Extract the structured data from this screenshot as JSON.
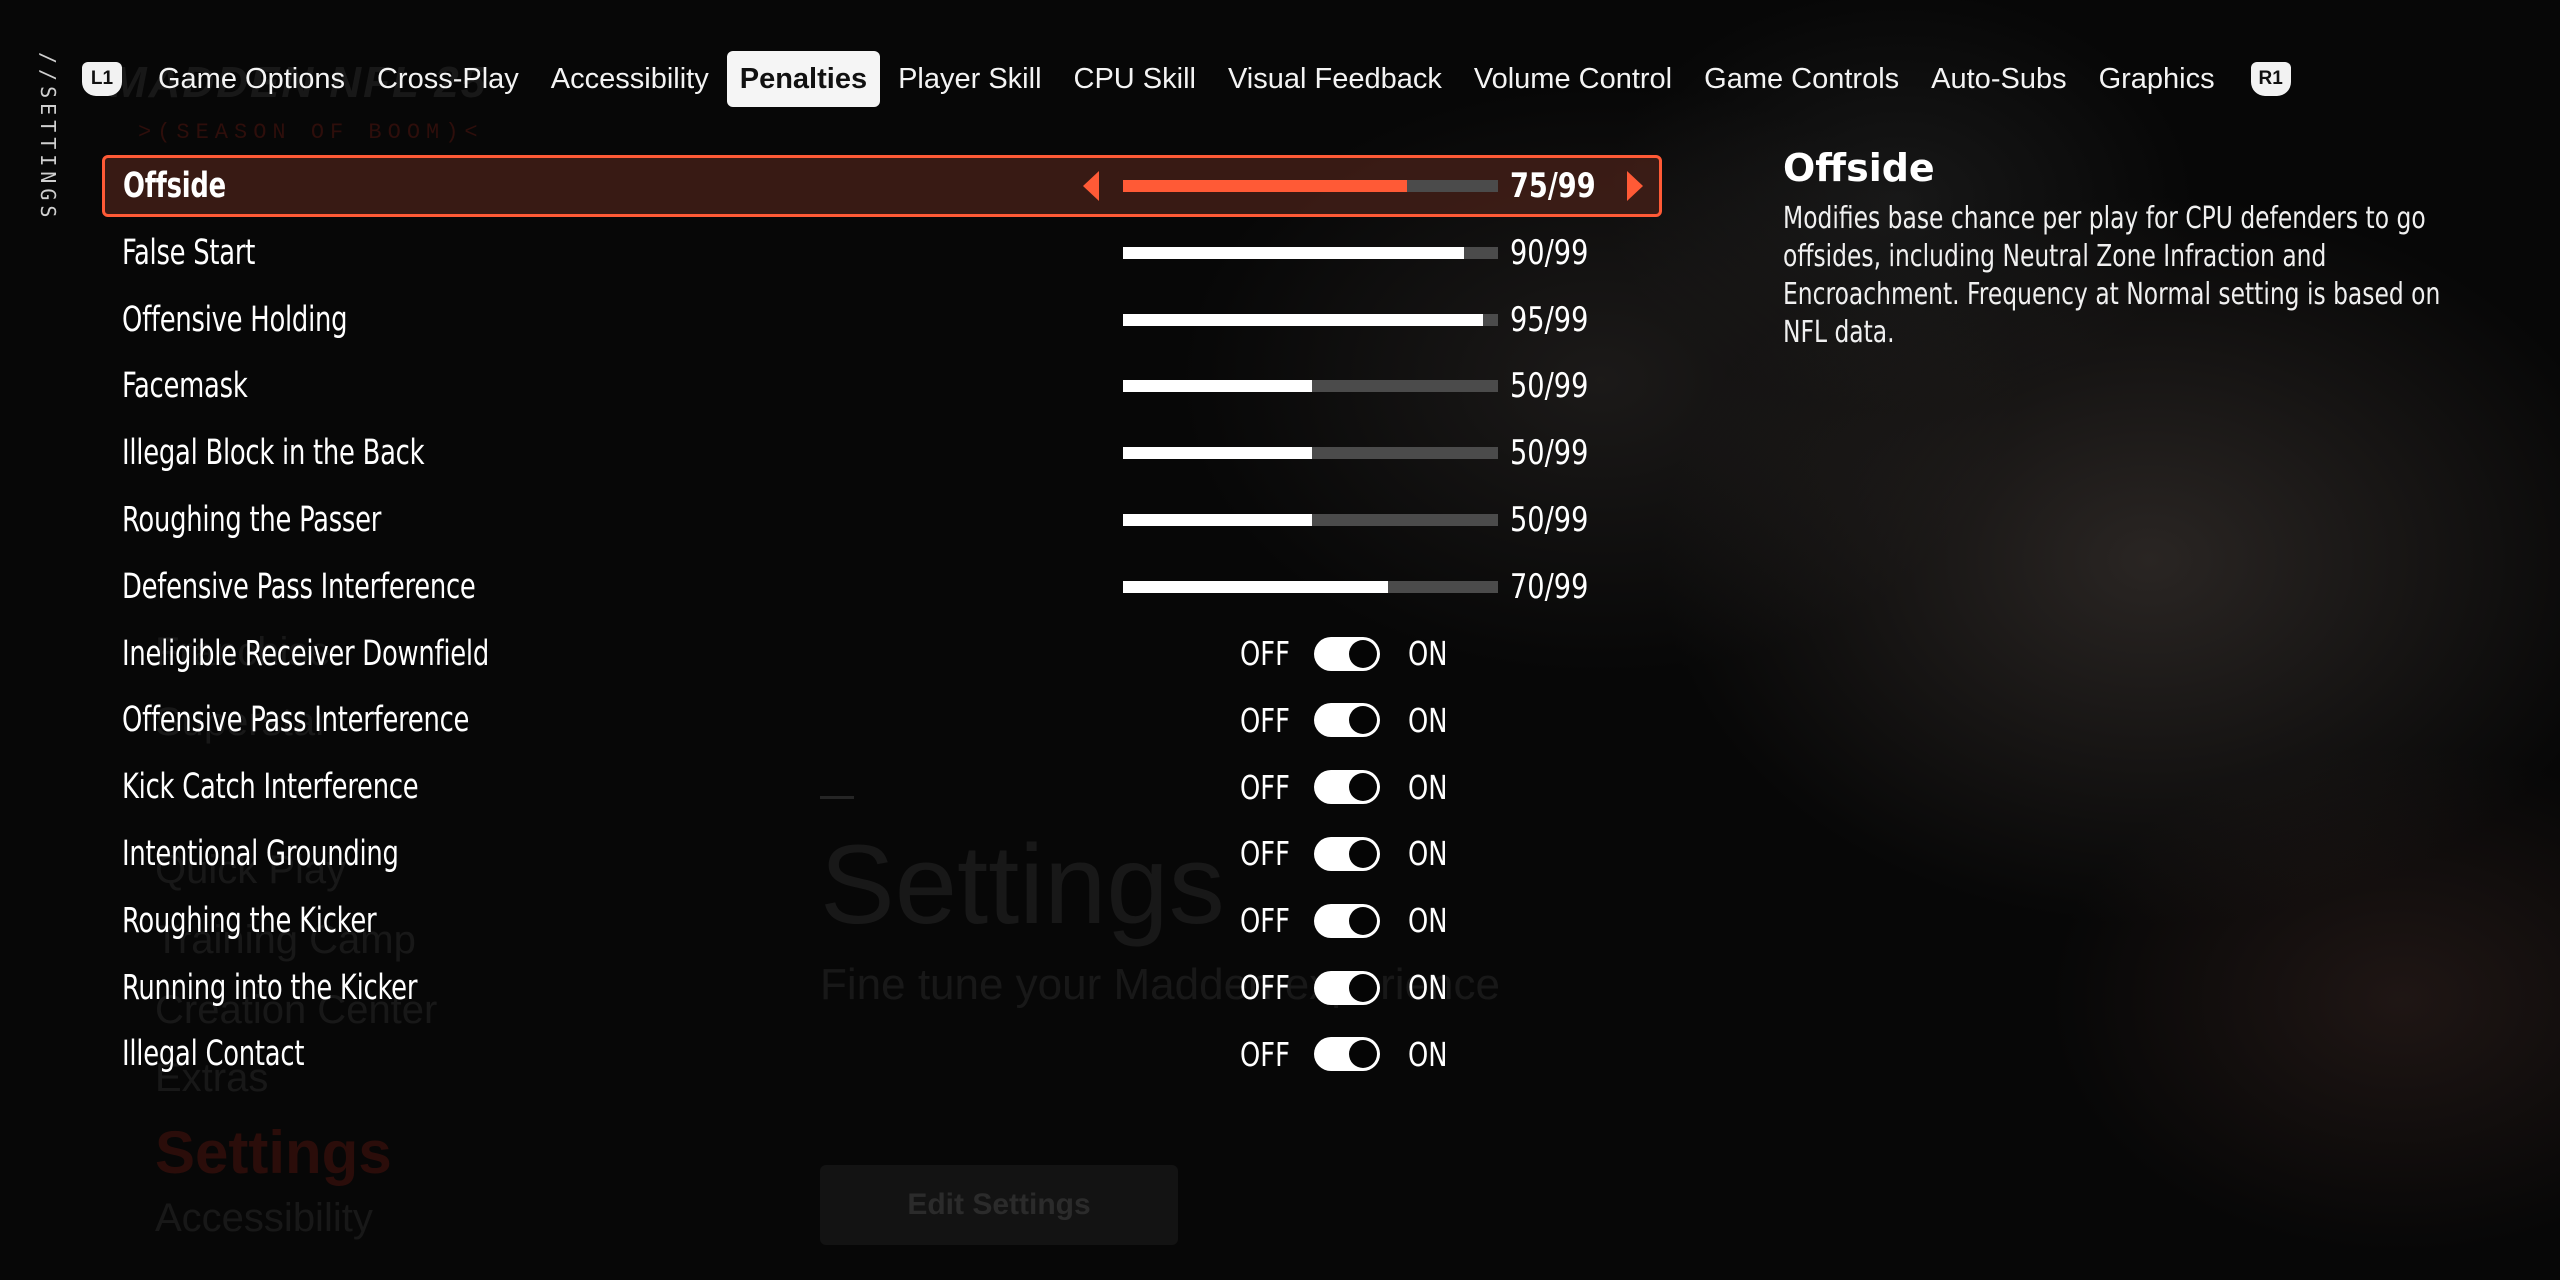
{
  "breadcrumb": "//SETTINGS",
  "background": {
    "logo": "MADDEN NFL 25",
    "season": ">(SEASON OF BOOM)<",
    "menu_items": [
      "Franchise",
      "Superstar",
      "Quick Play",
      "Training Camp",
      "Creation Center",
      "Extras"
    ],
    "menu_selected": "Settings",
    "menu_next": "Accessibility",
    "title": "Settings",
    "subtitle": "Fine tune your Madden experience",
    "button": "Edit Settings"
  },
  "tabbar": {
    "left_bumper": "L1",
    "right_bumper": "R1",
    "tabs": [
      {
        "label": "Game Options"
      },
      {
        "label": "Cross-Play"
      },
      {
        "label": "Accessibility"
      },
      {
        "label": "Penalties",
        "active": true
      },
      {
        "label": "Player Skill"
      },
      {
        "label": "CPU Skill"
      },
      {
        "label": "Visual Feedback"
      },
      {
        "label": "Volume Control"
      },
      {
        "label": "Game Controls"
      },
      {
        "label": "Auto-Subs"
      },
      {
        "label": "Graphics"
      }
    ]
  },
  "colors": {
    "accent": "#ff5a36",
    "track": "#4b4b4b",
    "selected_bg": "#46201a"
  },
  "settings": [
    {
      "label": "Offside",
      "type": "slider",
      "value": 75,
      "max": 99,
      "display": "75/99",
      "selected": true
    },
    {
      "label": "False Start",
      "type": "slider",
      "value": 90,
      "max": 99,
      "display": "90/99"
    },
    {
      "label": "Offensive Holding",
      "type": "slider",
      "value": 95,
      "max": 99,
      "display": "95/99"
    },
    {
      "label": "Facemask",
      "type": "slider",
      "value": 50,
      "max": 99,
      "display": "50/99"
    },
    {
      "label": "Illegal Block in the Back",
      "type": "slider",
      "value": 50,
      "max": 99,
      "display": "50/99"
    },
    {
      "label": "Roughing the Passer",
      "type": "slider",
      "value": 50,
      "max": 99,
      "display": "50/99"
    },
    {
      "label": "Defensive Pass Interference",
      "type": "slider",
      "value": 70,
      "max": 99,
      "display": "70/99"
    },
    {
      "label": "Ineligible Receiver Downfield",
      "type": "toggle",
      "on": true,
      "off_label": "OFF",
      "on_label": "ON"
    },
    {
      "label": "Offensive Pass Interference",
      "type": "toggle",
      "on": true,
      "off_label": "OFF",
      "on_label": "ON"
    },
    {
      "label": "Kick Catch Interference",
      "type": "toggle",
      "on": true,
      "off_label": "OFF",
      "on_label": "ON"
    },
    {
      "label": "Intentional Grounding",
      "type": "toggle",
      "on": true,
      "off_label": "OFF",
      "on_label": "ON"
    },
    {
      "label": "Roughing the Kicker",
      "type": "toggle",
      "on": true,
      "off_label": "OFF",
      "on_label": "ON"
    },
    {
      "label": "Running into the Kicker",
      "type": "toggle",
      "on": true,
      "off_label": "OFF",
      "on_label": "ON"
    },
    {
      "label": "Illegal Contact",
      "type": "toggle",
      "on": true,
      "off_label": "OFF",
      "on_label": "ON"
    }
  ],
  "description": {
    "title": "Offside",
    "body": "Modifies base chance per play for CPU defenders to go offsides, including Neutral Zone Infraction and Encroachment. Frequency at Normal setting is based on NFL data."
  }
}
